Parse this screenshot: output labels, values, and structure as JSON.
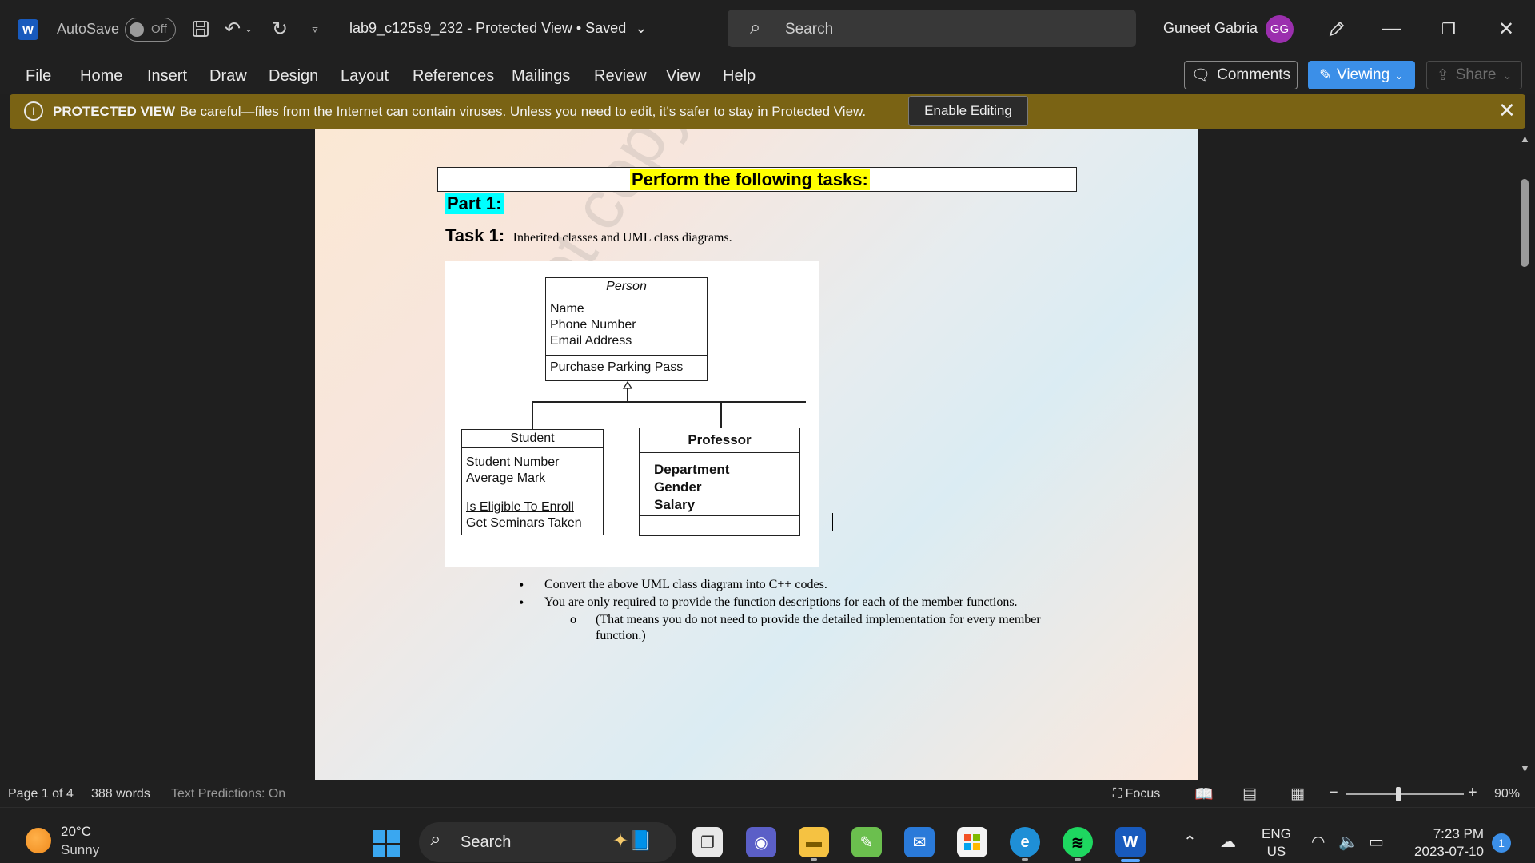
{
  "titlebar": {
    "autosave_label": "AutoSave",
    "autosave_state": "Off",
    "document_title": "lab9_c125s9_232  -  Protected View • Saved",
    "search_placeholder": "Search",
    "user_name": "Guneet Gabria",
    "user_initials": "GG"
  },
  "menu": {
    "items": [
      "File",
      "Home",
      "Insert",
      "Draw",
      "Design",
      "Layout",
      "References",
      "Mailings",
      "Review",
      "View",
      "Help"
    ],
    "comments_label": "Comments",
    "viewing_label": "Viewing",
    "share_label": "Share"
  },
  "protected_view": {
    "title": "PROTECTED VIEW",
    "message": "Be careful—files from the Internet can contain viruses. Unless you need to edit, it's safer to stay in Protected View.",
    "enable_label": "Enable Editing"
  },
  "document": {
    "heading": "Perform the following tasks:",
    "part": "Part 1:",
    "task_label": "Task 1:",
    "task_desc": "Inherited classes and UML class diagrams.",
    "watermark": "Do not copy from other students",
    "uml": {
      "person": {
        "name": "Person",
        "attributes": [
          "Name",
          "Phone Number",
          "Email Address"
        ],
        "methods": [
          "Purchase Parking Pass"
        ]
      },
      "student": {
        "name": "Student",
        "attributes": [
          "Student Number",
          "Average Mark"
        ],
        "methods": [
          "Is Eligible To Enroll",
          "Get Seminars Taken"
        ]
      },
      "professor": {
        "name": "Professor",
        "attributes": [
          "Department",
          "Gender",
          "Salary"
        ],
        "methods": []
      }
    },
    "bullets": [
      "Convert the above UML class diagram into C++ codes.",
      "You are only required to provide the function descriptions for each of the member functions."
    ],
    "sub_bullet": "(That means you do not need to provide the detailed implementation for every member function.)"
  },
  "status": {
    "page": "Page 1 of 4",
    "words": "388 words",
    "predictions": "Text Predictions: On",
    "focus": "Focus",
    "zoom": "90%"
  },
  "taskbar": {
    "temperature": "20°C",
    "condition": "Sunny",
    "search_placeholder": "Search",
    "lang_top": "ENG",
    "lang_bottom": "US",
    "time": "7:23 PM",
    "date": "2023-07-10",
    "notifications": "1"
  },
  "colors": {
    "accent": "#3b8fe8",
    "protected_bar": "#7a6314",
    "highlight_yellow": "#ffff00",
    "highlight_cyan": "#00ffff",
    "avatar": "#9b2fae"
  }
}
